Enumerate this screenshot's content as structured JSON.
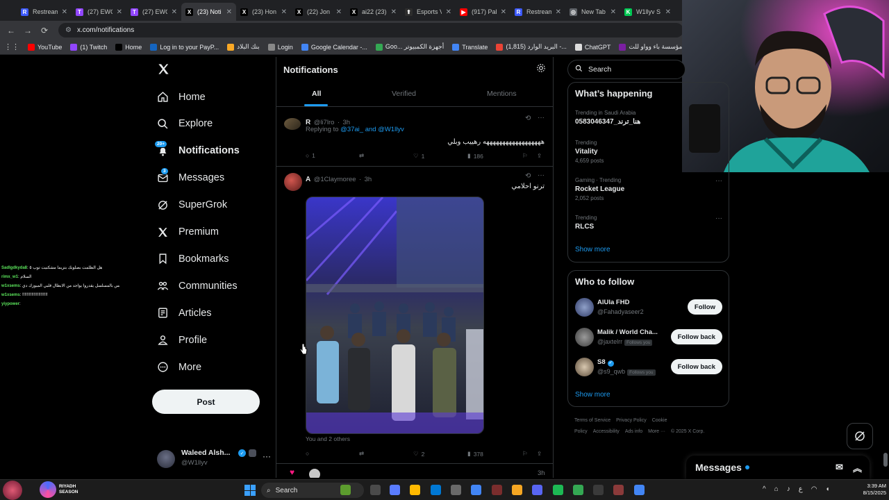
{
  "browser": {
    "tabs": [
      {
        "title": "Restream",
        "color": "#3d5afe",
        "glyph": "R"
      },
      {
        "title": "(27) EWC",
        "color": "#9146ff",
        "glyph": "T"
      },
      {
        "title": "(27) EWC",
        "color": "#9146ff",
        "glyph": "T"
      },
      {
        "title": "(23) Noti",
        "color": "#000000",
        "glyph": "X",
        "active": true
      },
      {
        "title": "(23) Hon",
        "color": "#000000",
        "glyph": "X"
      },
      {
        "title": "(22) Jon",
        "color": "#000000",
        "glyph": "X"
      },
      {
        "title": "ai22 (23)",
        "color": "#000000",
        "glyph": "X"
      },
      {
        "title": "Esports V",
        "color": "#2d2d2d",
        "glyph": "⬆"
      },
      {
        "title": "(917) Pal",
        "color": "#ff0000",
        "glyph": "▶"
      },
      {
        "title": "Restream",
        "color": "#3d5afe",
        "glyph": "R"
      },
      {
        "title": "New Tab",
        "color": "#5f6368",
        "glyph": "◎"
      },
      {
        "title": "W1llyv S",
        "color": "#00c853",
        "glyph": "K"
      }
    ],
    "url": "x.com/notifications",
    "bookmarks": [
      {
        "label": "YouTube",
        "color": "#ff0000"
      },
      {
        "label": "(1) Twitch",
        "color": "#9146ff"
      },
      {
        "label": "Home",
        "color": "#000000"
      },
      {
        "label": "Log in to your PayP...",
        "color": "#1565c0"
      },
      {
        "label": "بنك البلاد",
        "color": "#f9a825"
      },
      {
        "label": "Login",
        "color": "#888888"
      },
      {
        "label": "Google Calendar -...",
        "color": "#4285f4"
      },
      {
        "label": "Goo... أجهزة الكمبيوتر",
        "color": "#34a853"
      },
      {
        "label": "Translate",
        "color": "#4285f4"
      },
      {
        "label": "البريد الوارد (1,815) -...",
        "color": "#ea4335"
      },
      {
        "label": "ChatGPT",
        "color": "#dddddd"
      },
      {
        "label": "مؤسسة باء وواو للت...",
        "color": "#7b1fa2"
      },
      {
        "label": "StreamElem",
        "color": "#6a1b9a"
      }
    ]
  },
  "nav": {
    "items": [
      {
        "label": "Home",
        "icon": "home-icon"
      },
      {
        "label": "Explore",
        "icon": "search-icon"
      },
      {
        "label": "Notifications",
        "icon": "bell-icon",
        "badge": "20+"
      },
      {
        "label": "Messages",
        "icon": "envelope-icon",
        "badge": "3"
      },
      {
        "label": "SuperGrok",
        "icon": "grok-icon"
      },
      {
        "label": "Premium",
        "icon": "x-logo-icon"
      },
      {
        "label": "Bookmarks",
        "icon": "bookmark-icon"
      },
      {
        "label": "Communities",
        "icon": "people-icon"
      },
      {
        "label": "Articles",
        "icon": "article-icon"
      },
      {
        "label": "Profile",
        "icon": "person-icon"
      },
      {
        "label": "More",
        "icon": "more-circle-icon"
      }
    ],
    "post_label": "Post",
    "account": {
      "name": "Waleed Alsh...",
      "handle": "@W1llyv"
    }
  },
  "notifications": {
    "title": "Notifications",
    "tabs": [
      "All",
      "Verified",
      "Mentions"
    ],
    "tweets": [
      {
        "name": "R",
        "handle": "@li7lro",
        "time": "3h",
        "replying_prefix": "Replying to",
        "replying_to": "@37ai_ and @W1llyv",
        "text": "ههههههههههههههههههه رهييب وبلي",
        "replies": "1",
        "reposts": "",
        "likes": "1",
        "views": "186"
      },
      {
        "name": "A",
        "handle": "@1Claymoree",
        "time": "3h",
        "text": "ترنو احلامي",
        "liked_by": "You and 2 others",
        "replies": "",
        "reposts": "",
        "likes": "2",
        "views": "378"
      }
    ],
    "next_time": "3h"
  },
  "sidebar": {
    "search_placeholder": "Search",
    "happening_title": "What’s happening",
    "trends": [
      {
        "category": "Trending in Saudi Arabia",
        "name": "0583046347_هنا_ترند",
        "count": ""
      },
      {
        "category": "Trending",
        "name": "Vitality",
        "count": "4,659 posts"
      },
      {
        "category": "Gaming · Trending",
        "name": "Rocket League",
        "count": "2,052 posts"
      },
      {
        "category": "Trending",
        "name": "RLCS",
        "count": ""
      }
    ],
    "show_more": "Show more",
    "who_title": "Who to follow",
    "who": [
      {
        "name": "AlUla FHD",
        "handle": "@Fahadyaseer2",
        "button": "Follow",
        "follows_you": ""
      },
      {
        "name": "Malik / World Cha...",
        "handle": "@jaxtelrr",
        "button": "Follow back",
        "follows_you": "Follows you"
      },
      {
        "name": "S8",
        "handle": "@s9_qwb",
        "button": "Follow back",
        "follows_you": "Follows you"
      }
    ],
    "footer": [
      "Terms of Service",
      "Privacy Policy",
      "Cookie Policy",
      "Accessibility",
      "Ads info",
      "More ···",
      "© 2025 X Corp."
    ]
  },
  "messages_drawer": {
    "label": "Messages"
  },
  "stream_chat": [
    {
      "user": "Sadlgdkyda8",
      "text": ": هل الظلمت بصلوبك بتزيما مشكنيت توب ٥"
    },
    {
      "user": "rimx_w1",
      "text": ": السلام"
    },
    {
      "user": "w1xsems",
      "text": ": القطعه خايفه احرق على حد بس بالمسلسل يقدروا يواجد من الابطال قلبي الميوزك دي"
    },
    {
      "user": "w1xsems",
      "text": ": !!!!!!!!!!!!!!!!!!!!!!"
    },
    {
      "user": "yiypower",
      "text": ":"
    }
  ],
  "taskbar": {
    "search_label": "Search",
    "time": "3:39 AM",
    "date": "8/15/2025",
    "lang": "ع"
  },
  "colors": {
    "accent": "#1d9bf0",
    "background": "#000000",
    "border": "#2f3336",
    "muted": "#71767b"
  }
}
